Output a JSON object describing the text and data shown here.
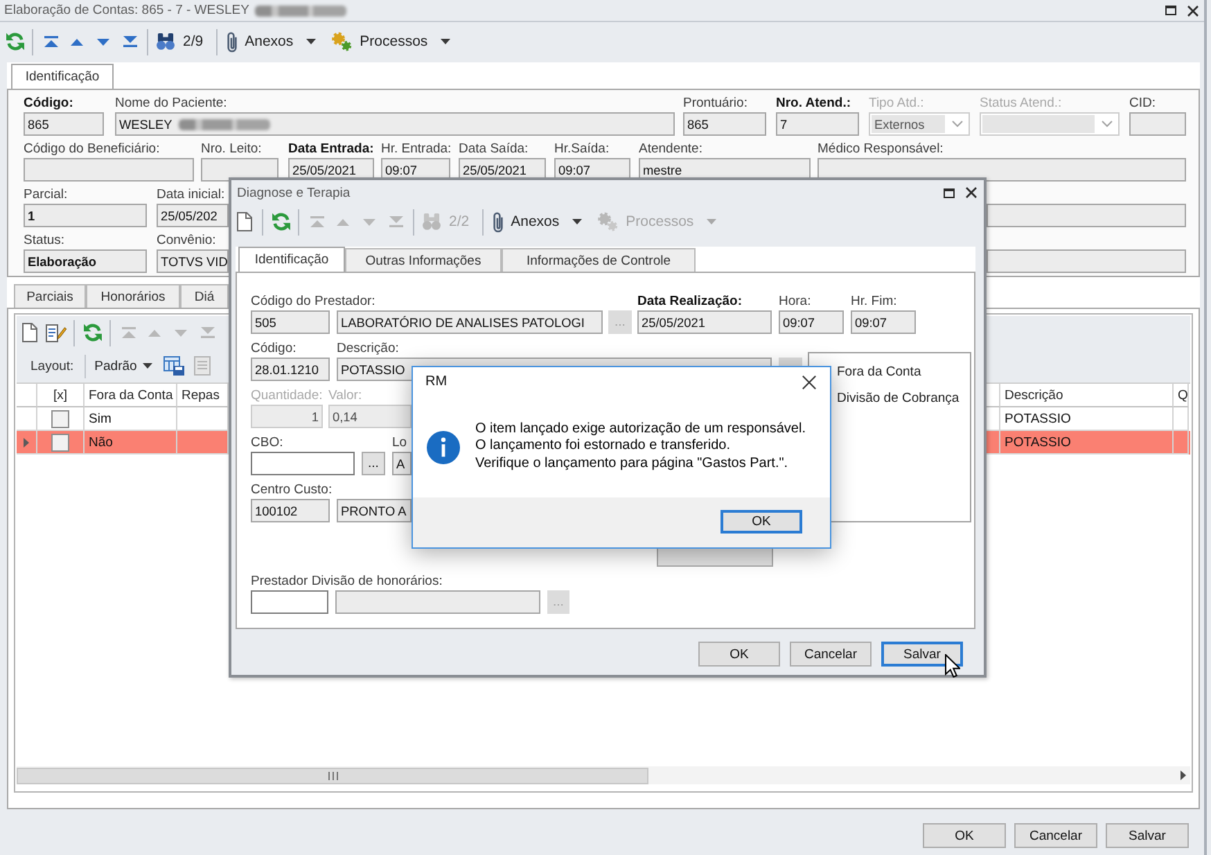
{
  "main_window": {
    "title": "Elaboração de Contas: 865 - 7 - WESLEY",
    "title_redacted": true,
    "toolbar": [
      {
        "kind": "refresh",
        "disabled": false
      },
      {
        "kind": "separator"
      },
      {
        "kind": "first",
        "disabled": false
      },
      {
        "kind": "previous",
        "disabled": false
      },
      {
        "kind": "next",
        "disabled": false
      },
      {
        "kind": "last",
        "disabled": false
      },
      {
        "kind": "separator"
      },
      {
        "kind": "find",
        "disabled": false
      },
      {
        "kind": "counter",
        "label": "2/9",
        "disabled": false
      },
      {
        "kind": "separator"
      },
      {
        "kind": "attachments",
        "label": "Anexos",
        "disabled": false
      },
      {
        "kind": "processes",
        "label": "Processos",
        "disabled": false
      }
    ],
    "tabs": [
      {
        "label": "Identificação",
        "selected": true
      }
    ],
    "form_rows": [
      [
        {
          "kind": "text",
          "label": "Código:",
          "value": "865",
          "required": true,
          "disabled": false,
          "strong": false
        },
        {
          "kind": "redacted",
          "label": "Nome do Paciente:",
          "value": "WESLEY",
          "required": false,
          "disabled": false,
          "strong": false
        },
        {
          "kind": "text",
          "label": "Prontuário:",
          "value": "865",
          "required": false,
          "disabled": false,
          "strong": false
        },
        {
          "kind": "text",
          "label": "Nro. Atend.:",
          "value": "7",
          "required": true,
          "disabled": false,
          "strong": false
        },
        {
          "kind": "combo",
          "label": "Tipo Atd.:",
          "value": "Externos",
          "required": false,
          "disabled": true,
          "strong": false
        },
        {
          "kind": "combo",
          "label": "Status Atend.:",
          "required": false,
          "disabled": true
        },
        {
          "kind": "text",
          "label": "CID:",
          "required": false,
          "disabled": false
        }
      ],
      [
        {
          "kind": "text",
          "label": "Código do Beneficiário:",
          "required": false,
          "disabled": false
        },
        {
          "kind": "text",
          "label": "Nro. Leito:",
          "required": false,
          "disabled": false
        },
        {
          "kind": "text",
          "label": "Data Entrada:",
          "value": "25/05/2021",
          "required": true,
          "disabled": false,
          "strong": false
        },
        {
          "kind": "text",
          "label": "Hr. Entrada:",
          "value": "09:07",
          "required": false,
          "disabled": false,
          "strong": false
        },
        {
          "kind": "text",
          "label": "Data Saída:",
          "value": "25/05/2021",
          "required": false,
          "disabled": false,
          "strong": false
        },
        {
          "kind": "text",
          "label": "Hr.Saída:",
          "value": "09:07",
          "required": false,
          "disabled": false,
          "strong": false
        },
        {
          "kind": "text",
          "label": "Atendente:",
          "value": "mestre",
          "required": false,
          "disabled": false,
          "strong": false
        },
        {
          "kind": "text",
          "label": "Médico Responsável:",
          "required": false,
          "disabled": false
        }
      ],
      [
        {
          "kind": "text",
          "label": "Parcial:",
          "value": "1",
          "required": false,
          "disabled": false,
          "strong": true
        },
        {
          "kind": "text",
          "label": "Data inicial:",
          "value": "25/05/202",
          "required": false,
          "disabled": false,
          "strong": false
        },
        {
          "kind": "text",
          "disabled": false
        }
      ],
      [
        {
          "kind": "text",
          "label": "Status:",
          "value": "Elaboração",
          "required": false,
          "disabled": false,
          "strong": true
        },
        {
          "kind": "text",
          "label": "Convênio:",
          "value": "TOTVS VID",
          "required": false,
          "disabled": false,
          "strong": false
        },
        {
          "kind": "text",
          "disabled": false
        }
      ]
    ],
    "lower_tabs": [
      {
        "label": "Parciais",
        "selected": false
      },
      {
        "label": "Honorários",
        "selected": false
      },
      {
        "label": "Diá",
        "selected": false
      }
    ],
    "detail_toolbar": [
      {
        "kind": "new",
        "disabled": false
      },
      {
        "kind": "edit",
        "disabled": false
      },
      {
        "kind": "separator"
      },
      {
        "kind": "refresh",
        "disabled": false
      },
      {
        "kind": "separator"
      },
      {
        "kind": "first",
        "disabled": true
      },
      {
        "kind": "previous",
        "disabled": true
      },
      {
        "kind": "next",
        "disabled": true
      },
      {
        "kind": "last",
        "disabled": true
      }
    ],
    "layout_bar": {
      "label": "Layout:",
      "preset": "Padrão",
      "tools": [
        {
          "kind": "save_layout",
          "disabled": false
        },
        {
          "kind": "layout_details",
          "disabled": true
        }
      ]
    },
    "grid": {
      "columns": [
        {
          "label": "[x]",
          "kind": "checkbox"
        },
        {
          "label": "Fora da Conta",
          "kind": "text"
        },
        {
          "label": "Repas",
          "kind": "text"
        },
        {
          "label": "Descrição",
          "kind": "text"
        },
        {
          "label": "Q",
          "kind": "text"
        }
      ],
      "rows": [
        {
          "selected": false,
          "cells": [
            {
              "kind": "checkbox",
              "checked": false
            },
            {
              "kind": "text",
              "text": "Sim"
            },
            {
              "kind": "text"
            },
            {
              "kind": "text",
              "text": "POTASSIO"
            },
            {
              "kind": "text"
            }
          ]
        },
        {
          "selected": true,
          "cells": [
            {
              "kind": "checkbox",
              "checked": false
            },
            {
              "kind": "text",
              "text": "Não"
            },
            {
              "kind": "text"
            },
            {
              "kind": "text",
              "text": "POTASSIO"
            },
            {
              "kind": "text"
            }
          ]
        }
      ]
    },
    "buttons": [
      {
        "label": "OK",
        "focused": false
      },
      {
        "label": "Cancelar",
        "focused": false
      },
      {
        "label": "Salvar",
        "focused": false
      }
    ]
  },
  "dialog": {
    "title": "Diagnose e Terapia",
    "toolbar": [
      {
        "kind": "new",
        "disabled": false
      },
      {
        "kind": "separator"
      },
      {
        "kind": "refresh",
        "disabled": false
      },
      {
        "kind": "separator"
      },
      {
        "kind": "first",
        "disabled": true
      },
      {
        "kind": "previous",
        "disabled": true
      },
      {
        "kind": "next",
        "disabled": true
      },
      {
        "kind": "last",
        "disabled": true
      },
      {
        "kind": "separator"
      },
      {
        "kind": "find",
        "disabled": true
      },
      {
        "kind": "counter",
        "label": "2/2",
        "disabled": true
      },
      {
        "kind": "separator"
      },
      {
        "kind": "attachments",
        "label": "Anexos",
        "disabled": false
      },
      {
        "kind": "processes",
        "label": "Processos",
        "disabled": true
      }
    ],
    "tabs": [
      {
        "label": "Identificação",
        "selected": true
      },
      {
        "label": "Outras Informações",
        "selected": false
      },
      {
        "label": "Informações de Controle",
        "selected": false
      }
    ],
    "form_rows": [
      [
        {
          "kind": "text",
          "label": "Código do Prestador:",
          "value": "505",
          "required": false,
          "disabled": false,
          "strong": false
        },
        {
          "kind": "text",
          "value": "LABORATÓRIO DE ANALISES PATOLOGI",
          "disabled": false,
          "strong": false
        },
        {
          "kind": "button",
          "label": "...",
          "disabled": true
        },
        {
          "kind": "text",
          "label": "Data Realização:",
          "value": "25/05/2021",
          "required": true,
          "disabled": false,
          "strong": false
        },
        {
          "kind": "text",
          "label": "Hora:",
          "value": "09:07",
          "required": false,
          "disabled": false,
          "strong": false
        },
        {
          "kind": "text",
          "label": "Hr. Fim:",
          "value": "09:07",
          "required": false,
          "disabled": false,
          "strong": false
        }
      ],
      [
        {
          "kind": "text",
          "label": "Código:",
          "value": "28.01.1210",
          "required": false,
          "disabled": false,
          "strong": false
        },
        {
          "kind": "text",
          "label": "Descrição:",
          "value": "POTASSIO",
          "required": false,
          "disabled": false,
          "strong": false
        },
        {
          "kind": "button",
          "disabled": true
        }
      ],
      [
        {
          "kind": "number",
          "label": "Quantidade:",
          "value": "1",
          "required": false,
          "disabled": true,
          "strong": false
        },
        {
          "kind": "text",
          "label": "Valor:",
          "value": "0,14",
          "required": false,
          "disabled": true,
          "strong": false
        }
      ],
      [
        {
          "kind": "input",
          "label": "CBO:",
          "required": false,
          "disabled": false
        },
        {
          "kind": "button",
          "label": "...",
          "disabled": false
        },
        {
          "kind": "text",
          "label": "Lo",
          "value": "A",
          "required": false,
          "disabled": false,
          "strong": false
        }
      ],
      [
        {
          "kind": "text",
          "label": "Centro Custo:",
          "value": "100102",
          "required": false,
          "disabled": false,
          "strong": false
        },
        {
          "kind": "text",
          "value": "PRONTO A",
          "disabled": false,
          "strong": false
        }
      ],
      [
        {
          "kind": "button",
          "disabled": false
        }
      ],
      [
        {
          "kind": "input",
          "label": "Prestador Divisão de honorários:",
          "required": false,
          "disabled": false
        },
        {
          "kind": "text",
          "disabled": false
        },
        {
          "kind": "button",
          "label": "...",
          "disabled": true
        }
      ]
    ],
    "options": [
      {
        "label": "Fora da Conta"
      },
      {
        "label": "Divisão de Cobrança"
      }
    ],
    "buttons": [
      {
        "label": "OK",
        "focused": false,
        "hovered": false
      },
      {
        "label": "Cancelar",
        "focused": false,
        "hovered": false
      },
      {
        "label": "Salvar",
        "focused": true,
        "hovered": true
      }
    ]
  },
  "message_box": {
    "title": "RM",
    "kind": "information",
    "lines": [
      "O item lançado exige autorização de um responsável.",
      "O lançamento foi estornado e transferido.",
      "Verifique o lançamento para página \"Gastos Part.\"."
    ],
    "buttons": [
      {
        "label": "OK",
        "focused": true
      }
    ]
  }
}
